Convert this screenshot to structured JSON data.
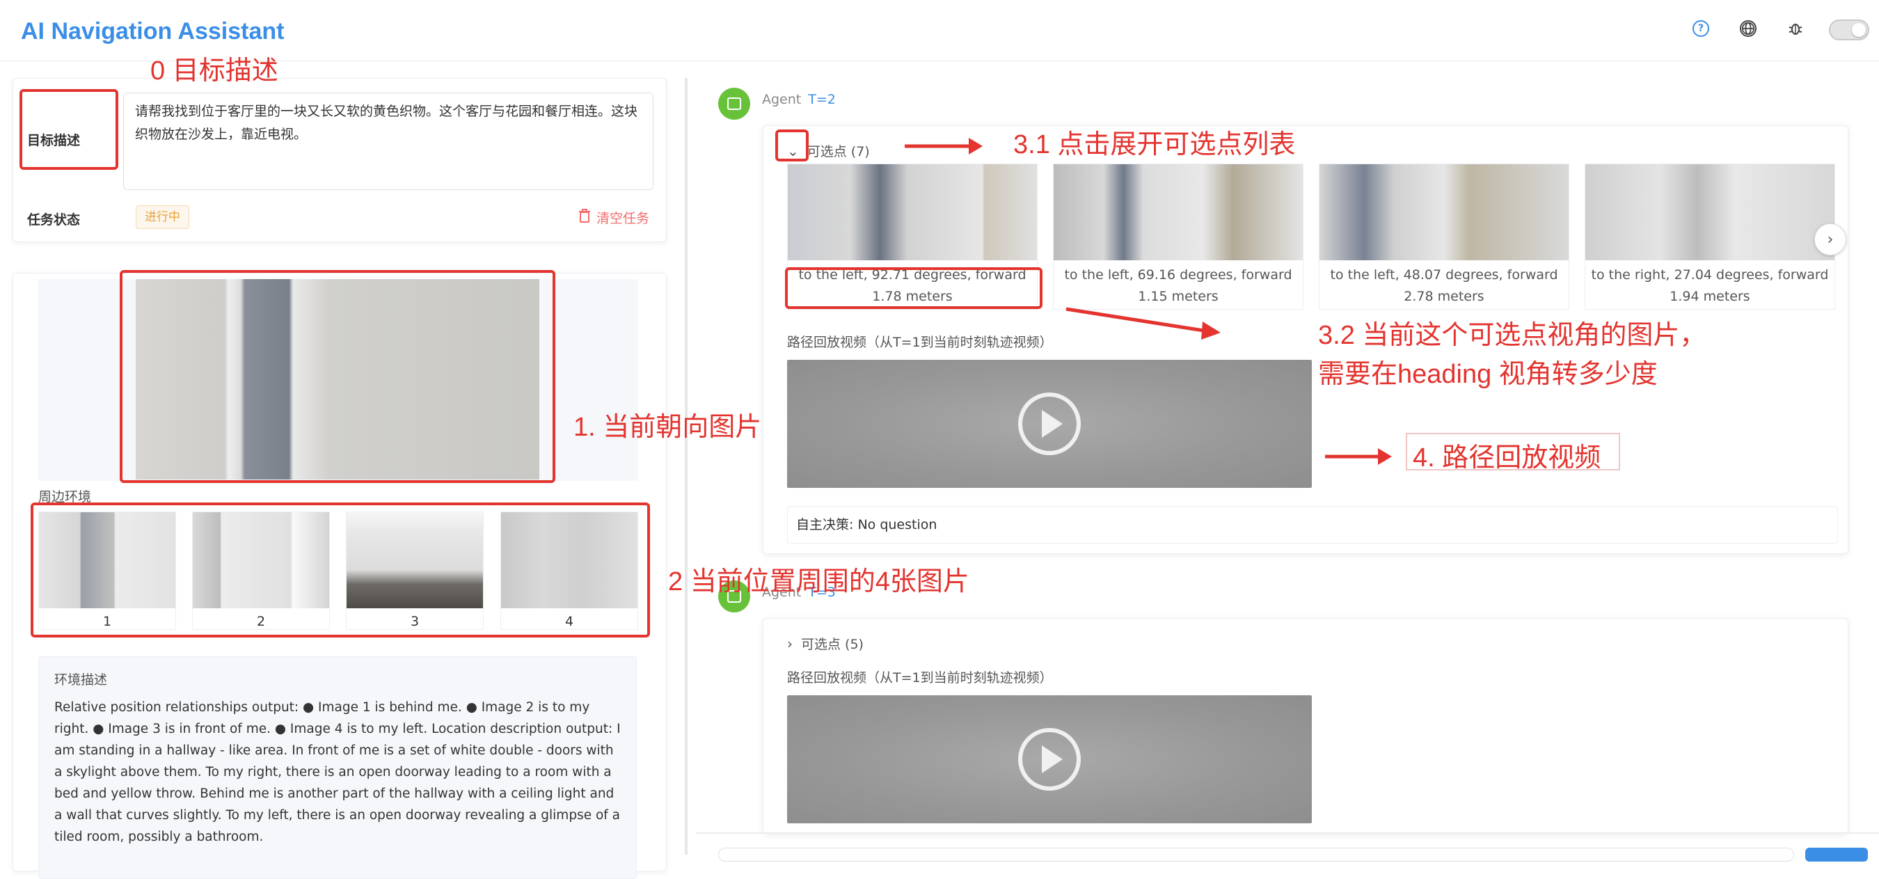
{
  "header": {
    "title": "AI Navigation Assistant",
    "help_icon": "question-circle-icon",
    "globe_icon": "globe-icon",
    "bug_icon": "bug-icon",
    "toggle_icon": "theme-toggle"
  },
  "annotations": {
    "a0": "0 目标描述",
    "a1": "1. 当前朝向图片",
    "a2": "2 当前位置周围的4张图片",
    "a31": "3.1 点击展开可选点列表",
    "a32_line1": "3.2 当前这个可选点视角的图片，",
    "a32_line2": "需要在heading 视角转多少度",
    "a4": "4. 路径回放视频",
    "color": "#e3342f"
  },
  "task": {
    "goal_label": "目标描述",
    "goal_text": "请帮我找到位于客厅里的一块又长又软的黄色织物。这个客厅与花园和餐厅相连。这块织物放在沙发上，靠近电视。",
    "status_label": "任务状态",
    "status_value": "进行中",
    "clear_label": "清空任务"
  },
  "scene": {
    "surround_label": "周边环境",
    "thumbnails": [
      "1",
      "2",
      "3",
      "4"
    ],
    "env_title": "环境描述",
    "env_text": "Relative position relationships output: ● Image 1 is behind me. ● Image 2 is to my right. ● Image 3 is in front of me. ● Image 4 is to my left. Location description output: I am standing in a hallway - like area. In front of me is a set of white double - doors with a skylight above them. To my right, there is an open doorway leading to a room with a bed and yellow throw. Behind me is another part of the hallway with a ceiling light and a wall that curves slightly. To my left, there is an open doorway revealing a glimpse of a tiled room, possibly a bathroom."
  },
  "messages": [
    {
      "agent": "Agent",
      "t_label": "T=2",
      "candidates_label": "可选点 (7)",
      "candidates": [
        "to the left, 92.71 degrees, forward 1.78 meters",
        "to the left, 69.16 degrees, forward 1.15 meters",
        "to the left, 48.07 degrees, forward 2.78 meters",
        "to the right, 27.04 degrees, forward 1.94 meters"
      ],
      "video_label": "路径回放视频（从T=1到当前时刻轨迹视频）",
      "decision_label": "自主决策:",
      "decision_value": "No question"
    },
    {
      "agent": "Agent",
      "t_label": "T=3",
      "candidates_label": "可选点 (5)",
      "video_label": "路径回放视频（从T=1到当前时刻轨迹视频）"
    }
  ]
}
